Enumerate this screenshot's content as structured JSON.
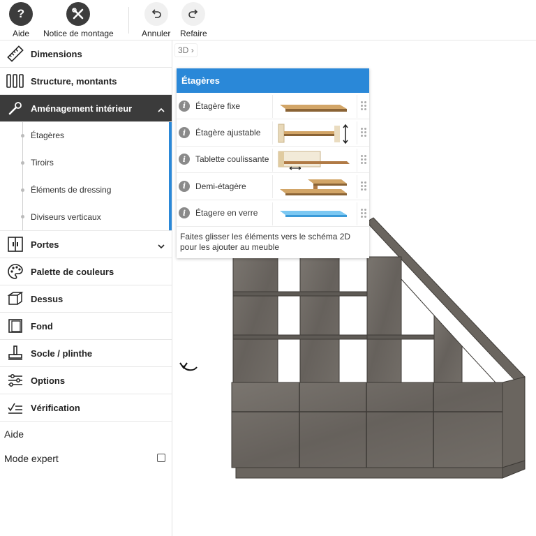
{
  "toolbar": {
    "help": "Aide",
    "assembly": "Notice de montage",
    "undo": "Annuler",
    "redo": "Refaire"
  },
  "sidebar": {
    "items": [
      {
        "label": "Dimensions",
        "icon": "ruler-icon"
      },
      {
        "label": "Structure, montants",
        "icon": "structure-icon"
      },
      {
        "label": "Aménagement intérieur",
        "icon": "wrench-icon"
      }
    ],
    "subitems": [
      "Étagères",
      "Tiroirs",
      "Éléments de dressing",
      "Diviseurs verticaux"
    ],
    "items2": [
      {
        "label": "Portes",
        "icon": "doors-icon"
      },
      {
        "label": "Palette de couleurs",
        "icon": "palette-icon"
      },
      {
        "label": "Dessus",
        "icon": "top-icon"
      },
      {
        "label": "Fond",
        "icon": "back-panel-icon"
      },
      {
        "label": "Socle / plinthe",
        "icon": "plinth-icon"
      },
      {
        "label": "Options",
        "icon": "sliders-icon"
      },
      {
        "label": "Vérification",
        "icon": "check-list-icon"
      }
    ],
    "help": "Aide",
    "expert": "Mode expert"
  },
  "canvas": {
    "view_label": "3D"
  },
  "panel": {
    "title": "Étagères",
    "rows": [
      "Étagère fixe",
      "Étagère ajustable",
      "Tablette coulissante",
      "Demi-étagère",
      "Étagere en verre"
    ],
    "note": "Faites glisser les éléments vers le schéma 2D pour les ajouter au meuble"
  },
  "colors": {
    "accent": "#2a88d8",
    "active_bg": "#3b3b3b",
    "wood": "#6e6964"
  }
}
